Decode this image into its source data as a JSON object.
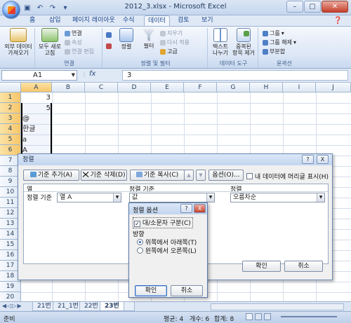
{
  "window": {
    "title": "2012_3.xlsx - Microsoft Excel"
  },
  "ribbon_tabs": [
    "홈",
    "삽입",
    "페이지 레이아웃",
    "수식",
    "데이터",
    "검토",
    "보기"
  ],
  "active_tab": "데이터",
  "ribbon": {
    "ext_data": {
      "label": "외부 데이터\n가져오기"
    },
    "connections": {
      "refresh_all": "모두 새로\n고침",
      "connections": "연결",
      "properties": "속성",
      "edit_links": "연결 편집",
      "group_label": "연결"
    },
    "sort_filter": {
      "sort": "정렬",
      "filter": "필터",
      "clear": "지우기",
      "reapply": "다시 적용",
      "advanced": "고급",
      "group_label": "정렬 및 필터"
    },
    "data_tools": {
      "text_to_columns": "텍스트\n나누기",
      "remove_duplicates": "중복된\n항목 제거",
      "group_label": "데이터 도구"
    },
    "outline": {
      "group": "그룹",
      "ungroup": "그룹 해제",
      "subtotal": "부분합",
      "group_label": "윤곽선"
    }
  },
  "formula_bar": {
    "name_box": "A1",
    "fx": "fx",
    "content": "3"
  },
  "columns": [
    "A",
    "B",
    "C",
    "D",
    "E",
    "F",
    "G",
    "H",
    "I",
    "J"
  ],
  "rows": [
    "1",
    "2",
    "3",
    "4",
    "5",
    "6",
    "7",
    "8",
    "9",
    "10",
    "11",
    "12",
    "13",
    "14",
    "15",
    "16",
    "17",
    "18",
    "19",
    "20"
  ],
  "cells": [
    {
      "value": "3"
    },
    {
      "value": "5"
    },
    {
      "value": "@"
    },
    {
      "value": "한글"
    },
    {
      "value": "a"
    },
    {
      "value": "A"
    }
  ],
  "sheet_tabs": [
    "21번",
    "21_1번",
    "22번",
    "23번"
  ],
  "active_sheet": "23번",
  "status": {
    "mode": "준비",
    "average": "평균: 4",
    "count": "개수: 6",
    "sum": "합계: 8"
  },
  "sort_dialog": {
    "title": "정렬",
    "help": "?",
    "close": "X",
    "add_level": "기준 추가(A)",
    "delete_level": "기준 삭제(D)",
    "copy_level": "기준 복사(C)",
    "up": "▲",
    "down": "▼",
    "options": "옵션(O)...",
    "has_headers": "내 데이터에 머리글 표시(H)",
    "col_header": "열",
    "sort_on_header": "정렬 기준",
    "order_header": "정렬",
    "row_label": "정렬 기준",
    "column_value": "열 A",
    "sort_on_value": "값",
    "order_value": "오름차순",
    "ok": "확인",
    "cancel": "취소"
  },
  "options_dialog": {
    "title": "정렬 옵션",
    "help": "?",
    "close": "X",
    "case_sensitive": "대/소문자 구분(C)",
    "case_checked": true,
    "orientation_label": "방향",
    "top_to_bottom": "위쪽에서 아래쪽(T)",
    "left_to_right": "왼쪽에서 오른쪽(L)",
    "ok": "확인",
    "cancel": "취소"
  }
}
